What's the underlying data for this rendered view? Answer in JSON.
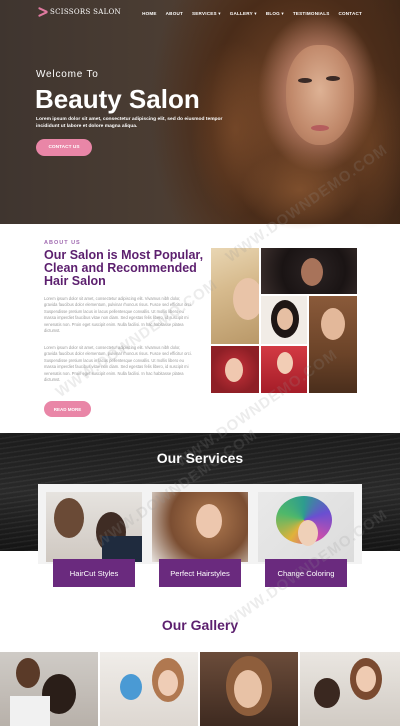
{
  "brand": {
    "name": "SCISSORS SALON",
    "accent": "#e986a7",
    "purple": "#5c1f6e"
  },
  "nav": {
    "items": [
      "HOME",
      "ABOUT",
      "SERVICES ▾",
      "GALLERY ▾",
      "BLOG ▾",
      "TESTIMONIALS",
      "CONTACT"
    ]
  },
  "hero": {
    "kicker": "Welcome To",
    "title": "Beauty Salon",
    "description": "Lorem ipsum dolor sit amet, consectetur adipiscing elit, sed do eiusmod tempor incididunt ut labore et dolore magna aliqua.",
    "button": "CONTACT US"
  },
  "about": {
    "kicker": "ABOUT US",
    "title": "Our Salon is Most Popular, Clean and Recommended Hair Salon",
    "paragraph1": "Lorem ipsum dolor sit amet, consectetur adipiscing elit. Vivamus nibh dolor, gravida faucibus dolor elementum, pulvinar rhoncus risus. Fusce sed efficitur orci. Suspendisse pretium lacus in lacus pellentesque convallis. Ut mollis libero eu massa imperdiet faucibus vitae non diam. Sed egestas felis libero, id suscipit mi venenatis non. Proin eget suscipit enim. Nulla facilisi. In hac habitasse platea dictumst.",
    "paragraph2": "Lorem ipsum dolor sit amet, consectetur adipiscing elit. Vivamus nibh dolor, gravida faucibus dolor elementum, pulvinar rhoncus risus. Fusce sed efficitur orci. Suspendisse pretium lacus in lacus pellentesque convallis. Ut mollis libero eu massa imperdiet faucibus vitae non diam. Sed egestas felis libero, id suscipit mi venenatis non. Proin eget suscipit enim. Nulla facilisi. In hac habitasse platea dictumst.",
    "button": "READ MORE"
  },
  "services": {
    "title": "Our Services",
    "cards": [
      {
        "label": "HairCut Styles"
      },
      {
        "label": "Perfect Hairstyles"
      },
      {
        "label": "Change Coloring"
      }
    ]
  },
  "gallery": {
    "title": "Our Gallery"
  },
  "watermarks": [
    "WWW.DOWNDEMO.COM",
    "WWW.DOWNDEMO.COM",
    "WWW.DOWNDEMO.COM",
    "WWW.DOWNDEMO.COM",
    "WWW.DOWNDEMO.COM"
  ]
}
